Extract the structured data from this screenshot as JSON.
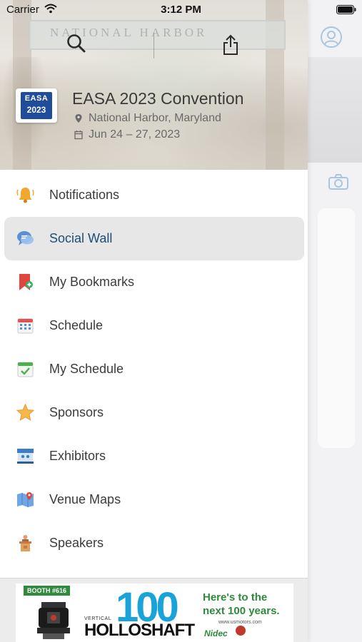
{
  "status_bar": {
    "carrier": "Carrier",
    "time": "3:12 PM"
  },
  "hero": {
    "backdrop_sign_text": "NATIONAL HARBOR",
    "logo": {
      "top": "EASA",
      "year": "2023"
    },
    "event_title": "EASA 2023 Convention",
    "location": "National Harbor, Maryland",
    "dates": "Jun 24 – 27, 2023"
  },
  "menu": {
    "items": [
      {
        "label": "Notifications",
        "icon": "bell-icon",
        "active": false
      },
      {
        "label": "Social Wall",
        "icon": "chat-bubbles-icon",
        "active": true
      },
      {
        "label": "My Bookmarks",
        "icon": "bookmark-icon",
        "active": false
      },
      {
        "label": "Schedule",
        "icon": "calendar-icon",
        "active": false
      },
      {
        "label": "My Schedule",
        "icon": "calendar-check-icon",
        "active": false
      },
      {
        "label": "Sponsors",
        "icon": "star-icon",
        "active": false
      },
      {
        "label": "Exhibitors",
        "icon": "booth-icon",
        "active": false
      },
      {
        "label": "Venue Maps",
        "icon": "map-icon",
        "active": false
      },
      {
        "label": "Speakers",
        "icon": "podium-icon",
        "active": false
      }
    ]
  },
  "ad": {
    "booth": "BOOTH #616",
    "hundred": "100",
    "vertical": "VERTICAL",
    "brand": "HOLLOSHAFT",
    "tagline_line1": "Here's to the",
    "tagline_line2": "next 100 years.",
    "url": "www.usmotors.com",
    "sponsor": "Nidec"
  },
  "colors": {
    "active_highlight": "#e7e7e7",
    "active_label": "#1f4d7a",
    "ad_blue": "#1aa3d9",
    "ad_green": "#2f8a3b"
  }
}
